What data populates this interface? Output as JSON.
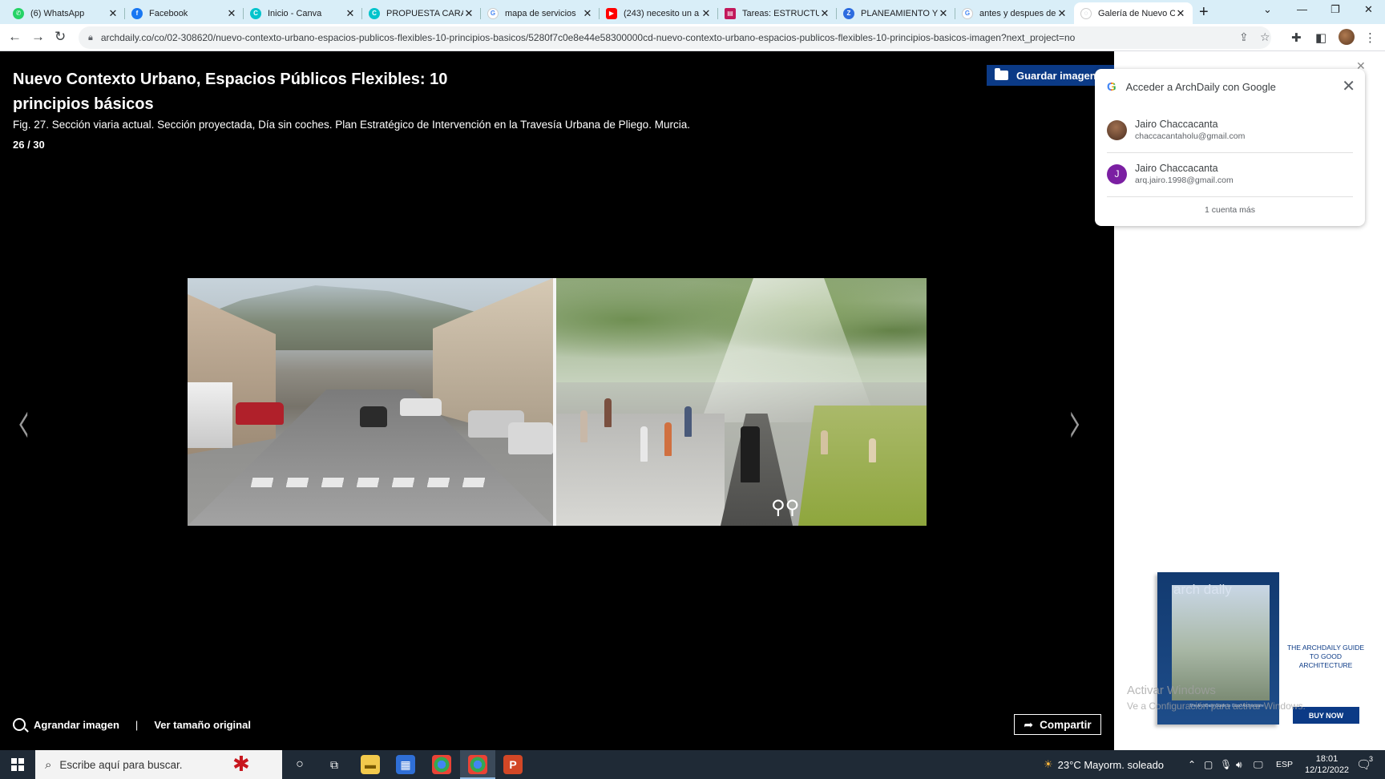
{
  "browser": {
    "tabs": [
      {
        "label": "(6) WhatsApp",
        "icon": "whatsapp-icon",
        "color": "#25d366"
      },
      {
        "label": "Facebook",
        "icon": "facebook-icon",
        "color": "#1877f2"
      },
      {
        "label": "Inicio - Canva",
        "icon": "canva-icon",
        "color": "#00c4cc"
      },
      {
        "label": "PROPUESTA CARA",
        "icon": "canva-icon",
        "color": "#00c4cc"
      },
      {
        "label": "mapa de servicios",
        "icon": "google-icon",
        "color": "#4285f4"
      },
      {
        "label": "(243) necesito un a",
        "icon": "youtube-icon",
        "color": "#ff0000"
      },
      {
        "label": "Tareas: ESTRUCTU",
        "icon": "tareas-icon",
        "color": "#c2185b"
      },
      {
        "label": "PLANEAMIENTO Y",
        "icon": "z-icon",
        "color": "#2d6cdf"
      },
      {
        "label": "antes y despues de",
        "icon": "google-icon",
        "color": "#4285f4"
      },
      {
        "label": "Galería de Nuevo C",
        "icon": "archdaily-icon",
        "color": "#9aa0a6"
      }
    ],
    "active_tab": 9,
    "url": "archdaily.co/co/02-308620/nuevo-contexto-urbano-espacios-publicos-flexibles-10-principios-basicos/5280f7c0e8e44e58300000cd-nuevo-contexto-urbano-espacios-publicos-flexibles-10-principios-basicos-imagen?next_project=no"
  },
  "gallery": {
    "title": "Nuevo Contexto Urbano, Espacios Públicos Flexibles: 10 principios básicos",
    "caption": "Fig. 27. Sección viaria actual. Sección proyectada, Día sin coches. Plan Estratégico de Intervención en la Travesía Urbana de Pliego. Murcia.",
    "counter": "26 / 30",
    "save_label": "Guardar imagen",
    "prev_arrow": "‹",
    "next_arrow": "›",
    "enlarge_label": "Agrandar imagen",
    "separator": "|",
    "original_size_label": "Ver tamaño original",
    "share_label": "Compartir"
  },
  "google_signin": {
    "title": "Acceder a ArchDaily con Google",
    "accounts": [
      {
        "name": "Jairo Chaccacanta",
        "email": "chaccacantaholu@gmail.com",
        "avatar_letter": "",
        "avatar_color": "#6d4c3a"
      },
      {
        "name": "Jairo Chaccacanta",
        "email": "arq.jairo.1998@gmail.com",
        "avatar_letter": "J",
        "avatar_color": "#7b1fa2"
      }
    ],
    "more_label": "1 cuenta más"
  },
  "ad": {
    "brand": "arch daily",
    "cover_text": "The ArchDaily Guide to Good Architecture",
    "headline": "THE ARCHDAILY GUIDE TO GOOD ARCHITECTURE",
    "cta": "BUY NOW"
  },
  "watermark": {
    "line1": "Activar Windows",
    "line2": "Ve a Configuración para activar Windows."
  },
  "taskbar": {
    "search_placeholder": "Escribe aquí para buscar.",
    "weather": "23°C  Mayorm. soleado",
    "lang": "ESP",
    "time": "18:01",
    "date": "12/12/2022",
    "notifications": "3"
  }
}
